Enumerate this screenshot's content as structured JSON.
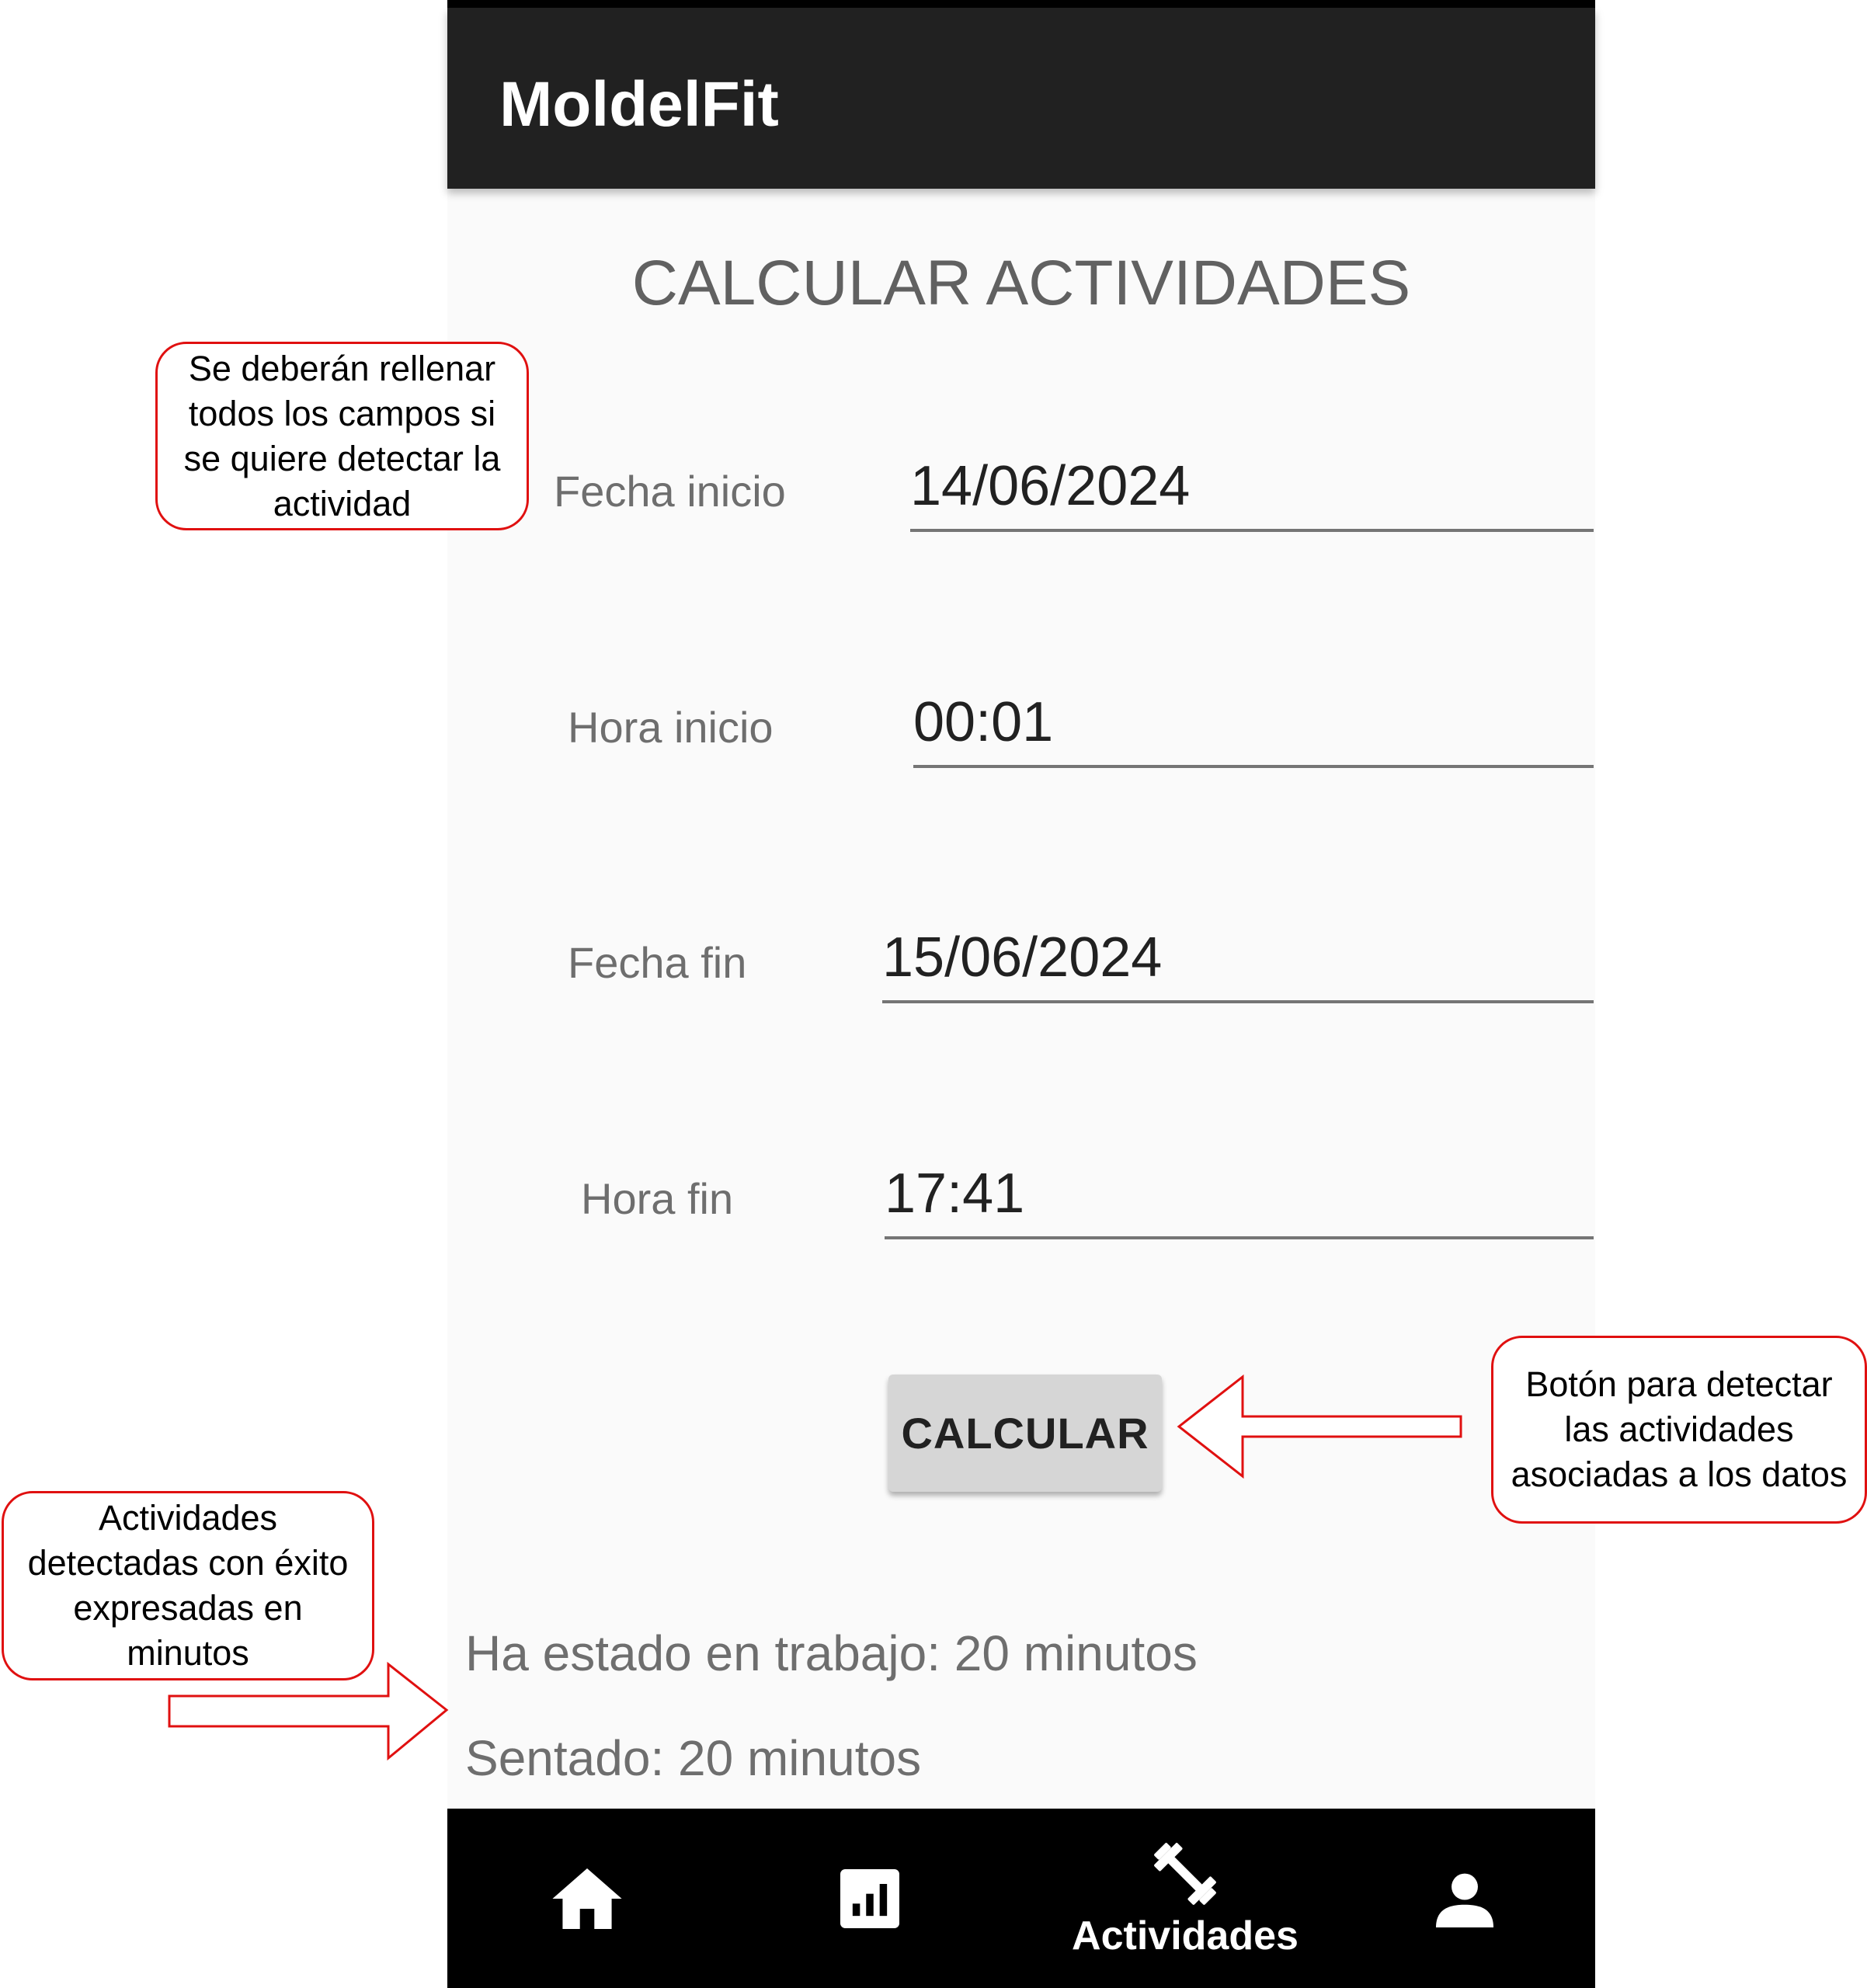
{
  "app": {
    "title": "MoldelFit"
  },
  "screen": {
    "title": "CALCULAR ACTIVIDADES"
  },
  "form": {
    "start_date_label": "Fecha inicio",
    "start_date_value": "14/06/2024",
    "start_time_label": "Hora inicio",
    "start_time_value": "00:01",
    "end_date_label": "Fecha fin",
    "end_date_value": "15/06/2024",
    "end_time_label": "Hora fin",
    "end_time_value": "17:41",
    "calculate_label": "CALCULAR"
  },
  "results": {
    "work": "Ha estado en trabajo: 20 minutos",
    "sitting": "Sentado: 20 minutos"
  },
  "nav": {
    "items": [
      {
        "icon": "home-icon"
      },
      {
        "icon": "bar-chart-icon"
      },
      {
        "icon": "dumbbell-icon",
        "label": "Actividades",
        "active": true
      },
      {
        "icon": "person-icon"
      }
    ]
  },
  "annotations": {
    "fill_fields": "Se deberán rellenar todos los campos si se quiere detectar la actividad",
    "button": "Botón para detectar las actividades asociadas a los datos",
    "results": "Actividades detectadas con éxito expresadas en minutos"
  },
  "colors": {
    "appbar": "#212121",
    "navbar": "#000000",
    "background": "#fafafa",
    "annotation_border": "#e01010"
  }
}
